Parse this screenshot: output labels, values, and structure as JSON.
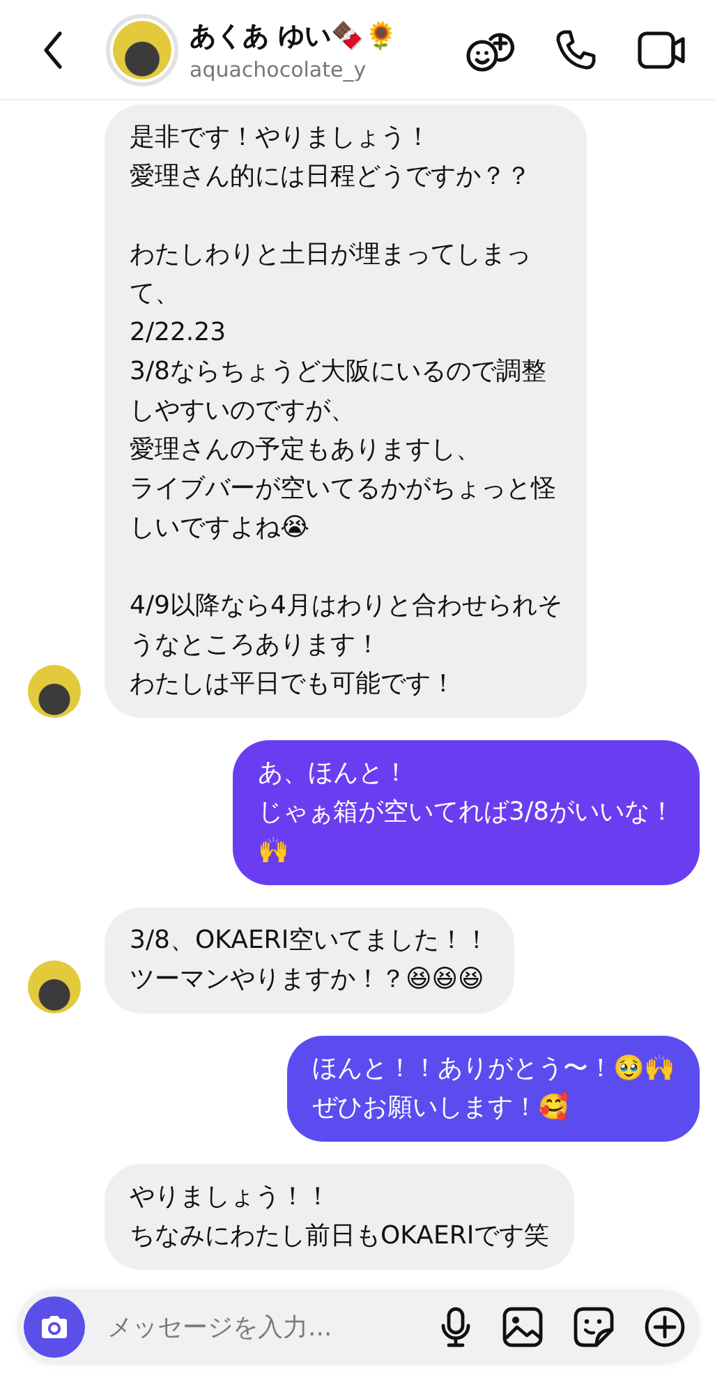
{
  "header": {
    "name": "あくあ ゆい🍫🌻",
    "username": "aquachocolate_y"
  },
  "messages": [
    {
      "kind": "incoming",
      "avatar": true,
      "paragraphs": [
        [
          "是非です！やりましょう！",
          "愛理さん的には日程どうですか？？"
        ],
        [
          "わたしわりと土日が埋まってしまっ",
          "て、",
          "2/22.23",
          "3/8ならちょうど大阪にいるので調整",
          "しやすいのですが、",
          "愛理さんの予定もありますし、",
          "ライブバーが空いてるかがちょっと怪",
          "しいですよね😭"
        ],
        [
          "4/9以降なら4月はわりと合わせられそ",
          "うなところあります！",
          "わたしは平日でも可能です！"
        ]
      ]
    },
    {
      "kind": "outgoing",
      "avatar": false,
      "paragraphs": [
        [
          "あ、ほんと！",
          "じゃぁ箱が空いてれば3/8がいいな！",
          "🙌"
        ]
      ]
    },
    {
      "kind": "incoming",
      "avatar": true,
      "paragraphs": [
        [
          "3/8、OKAERI空いてました！！",
          "ツーマンやりますか！？😆😆😆"
        ]
      ]
    },
    {
      "kind": "outgoing",
      "avatar": false,
      "paragraphs": [
        [
          "ほんと！！ありがとう〜！🥹🙌",
          "ぜひお願いします！🥰"
        ]
      ]
    },
    {
      "kind": "incoming",
      "avatar": false,
      "paragraphs": [
        [
          "やりましょう！！",
          "ちなみにわたし前日もOKAERIです笑"
        ]
      ]
    }
  ],
  "composer": {
    "placeholder": "メッセージを入力..."
  }
}
